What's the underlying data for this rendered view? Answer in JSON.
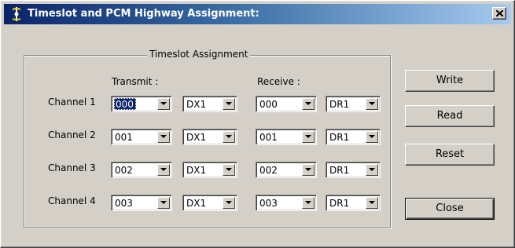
{
  "window": {
    "title": "Timeslot and PCM Highway Assignment:",
    "close_glyph": "✕"
  },
  "group": {
    "title": "Timeslot Assignment",
    "transmit_label": "Transmit :",
    "receive_label": "Receive :"
  },
  "rows": [
    {
      "label": "Channel 1",
      "tx_slot": "000",
      "tx_highway": "DX1",
      "rx_slot": "000",
      "rx_highway": "DR1"
    },
    {
      "label": "Channel 2",
      "tx_slot": "001",
      "tx_highway": "DX1",
      "rx_slot": "001",
      "rx_highway": "DR1"
    },
    {
      "label": "Channel 3",
      "tx_slot": "002",
      "tx_highway": "DX1",
      "rx_slot": "002",
      "rx_highway": "DR1"
    },
    {
      "label": "Channel 4",
      "tx_slot": "003",
      "tx_highway": "DX1",
      "rx_slot": "003",
      "rx_highway": "DR1"
    }
  ],
  "buttons": {
    "write": "Write",
    "read": "Read",
    "reset": "Reset",
    "close": "Close"
  },
  "icons": {
    "app": "pcm-app-icon",
    "dropdown": "chevron-down-icon",
    "close": "close-icon"
  },
  "colors": {
    "titlebar_start": "#0a246a",
    "titlebar_end": "#a6caf0",
    "face": "#d4d0c8",
    "selection": "#0a246a"
  }
}
